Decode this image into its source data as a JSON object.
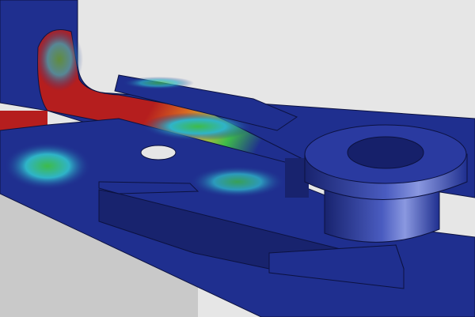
{
  "scene": {
    "colors": {
      "background_light": "#e6e6e6",
      "background_dark": "#c9c9c9",
      "low_stress": "#1f2f8f",
      "low_stress_dark": "#18236e",
      "mid_stress_cyan": "#2fb4c8",
      "mid_stress_green": "#3dbb4a",
      "high_stress_yellow": "#c8c23a",
      "high_stress_orange": "#d86a22",
      "max_stress_red": "#b51e1e",
      "edge": "#0c1240"
    }
  }
}
